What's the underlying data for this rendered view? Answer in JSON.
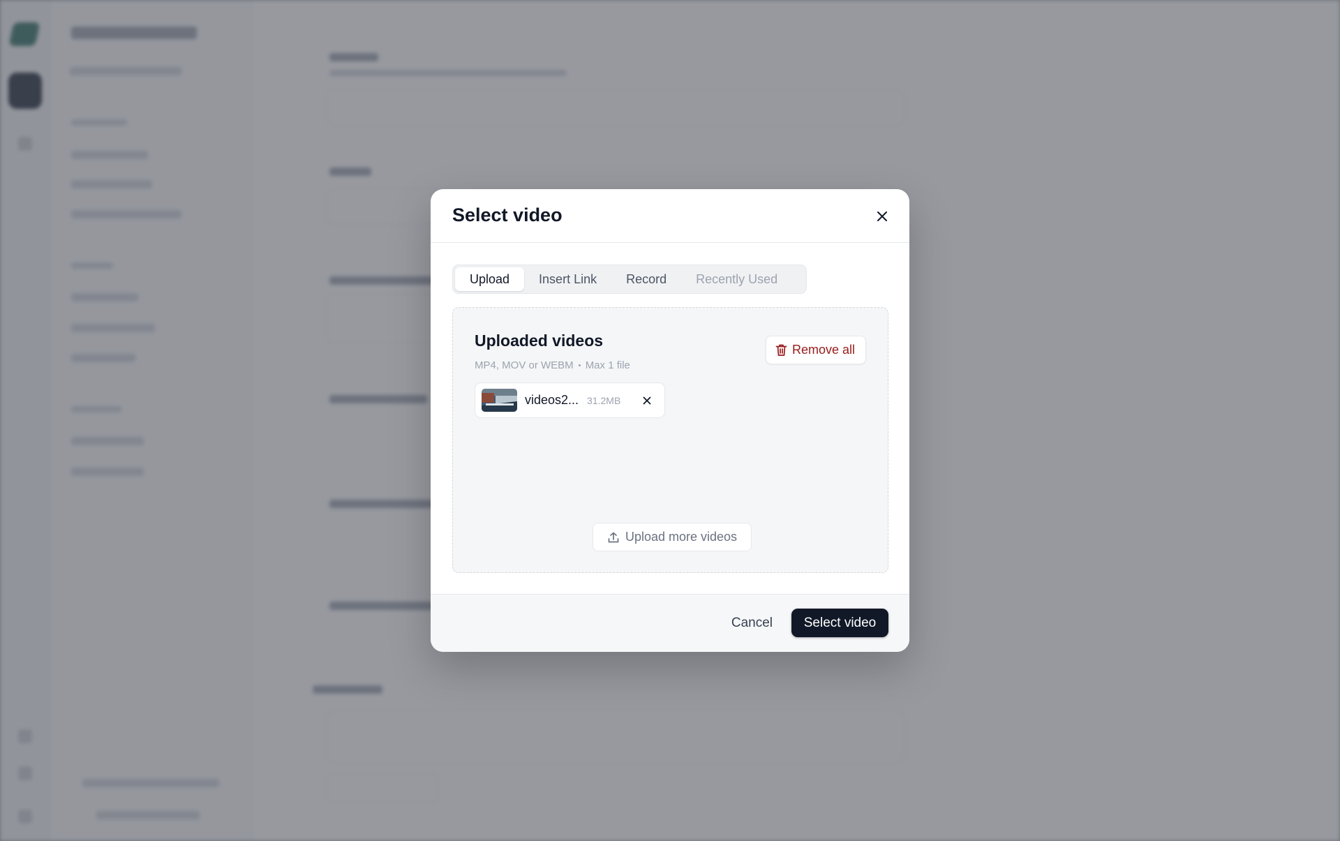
{
  "modal": {
    "title": "Select video",
    "tabs": [
      {
        "label": "Upload",
        "state": "active"
      },
      {
        "label": "Insert Link",
        "state": "normal"
      },
      {
        "label": "Record",
        "state": "normal"
      },
      {
        "label": "Recently Used",
        "state": "disabled"
      }
    ],
    "uploads": {
      "title": "Uploaded videos",
      "formats": "MP4, MOV or WEBM",
      "limit": "Max 1 file",
      "remove_all_label": "Remove all",
      "files": [
        {
          "name": "videos2...",
          "size": "31.2MB"
        }
      ],
      "upload_more_label": "Upload more videos"
    },
    "footer": {
      "cancel_label": "Cancel",
      "confirm_label": "Select video"
    }
  },
  "colors": {
    "overlay": "#4b505a",
    "primary_button": "#111827",
    "danger_text": "#991b1b",
    "muted_text": "#9ca3af"
  },
  "icons": [
    "close-icon",
    "trash-icon",
    "video-thumbnail",
    "remove-file-icon",
    "upload-icon"
  ]
}
